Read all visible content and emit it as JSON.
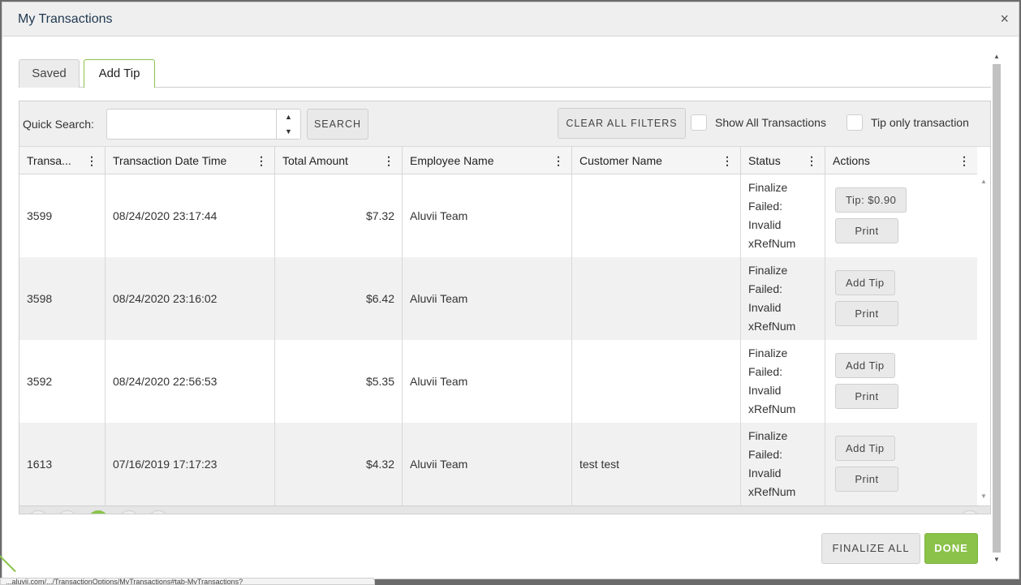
{
  "modal": {
    "title": "My Transactions",
    "close_icon": "×"
  },
  "tabs": [
    {
      "label": "Saved",
      "active": false
    },
    {
      "label": "Add Tip",
      "active": true
    }
  ],
  "toolbar": {
    "quick_search_label": "Quick Search:",
    "quick_search_value": "",
    "search_label": "SEARCH",
    "clear_filters_label": "CLEAR ALL FILTERS",
    "show_all_label": "Show All Transactions",
    "tip_only_label": "Tip only transaction"
  },
  "columns": [
    "Transa...",
    "Transaction Date Time",
    "Total Amount",
    "Employee Name",
    "Customer Name",
    "Status",
    "Actions"
  ],
  "rows": [
    {
      "id": "3599",
      "datetime": "08/24/2020 23:17:44",
      "amount": "$7.32",
      "employee": "Aluvii Team",
      "customer": "",
      "status": [
        "Finalize",
        "Failed:",
        "Invalid",
        "xRefNum"
      ],
      "tip_action": "Tip: $0.90",
      "print_action": "Print"
    },
    {
      "id": "3598",
      "datetime": "08/24/2020 23:16:02",
      "amount": "$6.42",
      "employee": "Aluvii Team",
      "customer": "",
      "status": [
        "Finalize",
        "Failed:",
        "Invalid",
        "xRefNum"
      ],
      "tip_action": "Add Tip",
      "print_action": "Print"
    },
    {
      "id": "3592",
      "datetime": "08/24/2020 22:56:53",
      "amount": "$5.35",
      "employee": "Aluvii Team",
      "customer": "",
      "status": [
        "Finalize",
        "Failed:",
        "Invalid",
        "xRefNum"
      ],
      "tip_action": "Add Tip",
      "print_action": "Print"
    },
    {
      "id": "1613",
      "datetime": "07/16/2019 17:17:23",
      "amount": "$4.32",
      "employee": "Aluvii Team",
      "customer": "test test",
      "status": [
        "Finalize",
        "Failed:",
        "Invalid",
        "xRefNum"
      ],
      "tip_action": "Add Tip",
      "print_action": "Print"
    }
  ],
  "footer": {
    "finalize_all_label": "FINALIZE ALL",
    "done_label": "DONE"
  },
  "statusbar": {
    "url_text": "...aluvii.com/.../TransactionOptions/MyTransactions#tab-MyTransactions?"
  },
  "colors": {
    "accent": "#8bc34a",
    "header_bg": "#efefef",
    "alt_row": "#f1f1f1"
  }
}
